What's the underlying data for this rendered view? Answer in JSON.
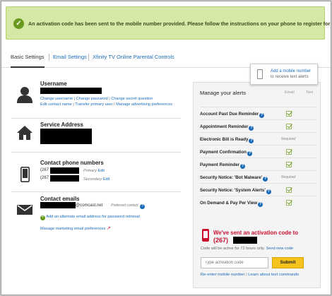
{
  "banner": {
    "message": "An activation code has been sent to the mobile number provided. Please follow the instructions on your phone to register for text alerts."
  },
  "tabs": [
    {
      "label": "Basic Settings",
      "active": true
    },
    {
      "label": "Email Settings",
      "active": false
    },
    {
      "label": "Xfinity TV Online Parental Controls",
      "active": false
    }
  ],
  "tooltip": {
    "line1": "Add a mobile number",
    "line2": "to receive text alerts"
  },
  "username": {
    "title": "Username",
    "links_row1": [
      "Change username",
      "Change password",
      "Change secret question"
    ],
    "links_row2": [
      "Edit contact name",
      "Transfer primary user",
      "Manage advertising preferences"
    ]
  },
  "service": {
    "title": "Service Address"
  },
  "phones": {
    "title": "Contact phone numbers",
    "primary_prefix": "(267",
    "primary_label": "Primary",
    "primary_edit": "Edit",
    "secondary_prefix": "(267",
    "secondary_label": "Secondary",
    "secondary_edit": "Edit"
  },
  "emails": {
    "title": "Contact emails",
    "email_suffix": "@comcast.net",
    "preferred_label": "Preferred contact",
    "add_alt": "Add an alternate email address for password retrieval",
    "manage_marketing": "Manage marketing email preferences"
  },
  "alerts": {
    "title": "Manage your alerts",
    "col_email": "Email",
    "col_text": "Text",
    "rows": [
      {
        "label": "Account Past Due Reminder",
        "status": "check"
      },
      {
        "label": "Appointment Reminder",
        "status": "check"
      },
      {
        "label": "Electronic Bill is Ready",
        "status": "Required"
      },
      {
        "label": "Payment Confirmation",
        "status": "check"
      },
      {
        "label": "Payment Reminder",
        "status": "check"
      },
      {
        "label": "Security Notice: 'Bot Malware'",
        "status": "Required"
      },
      {
        "label": "Security Notice: 'System Alerts'",
        "status": "check"
      },
      {
        "label": "On Demand & Pay Per View",
        "status": "check"
      }
    ]
  },
  "activation": {
    "heading": "We've sent an activation code to",
    "number_prefix": "(267)",
    "active_note": "Code will be active for 72 hours only.",
    "send_new": "Send new code",
    "input_placeholder": "Type activation code",
    "submit_label": "Submit",
    "reenter": "Re-enter mobile number",
    "separator": "|",
    "learn_more": "Learn about text commands"
  },
  "colors": {
    "link": "#1a6bb7",
    "banner_bg": "#d6e8a5",
    "accent_red": "#c8102e",
    "submit_yellow": "#f6c21c"
  }
}
